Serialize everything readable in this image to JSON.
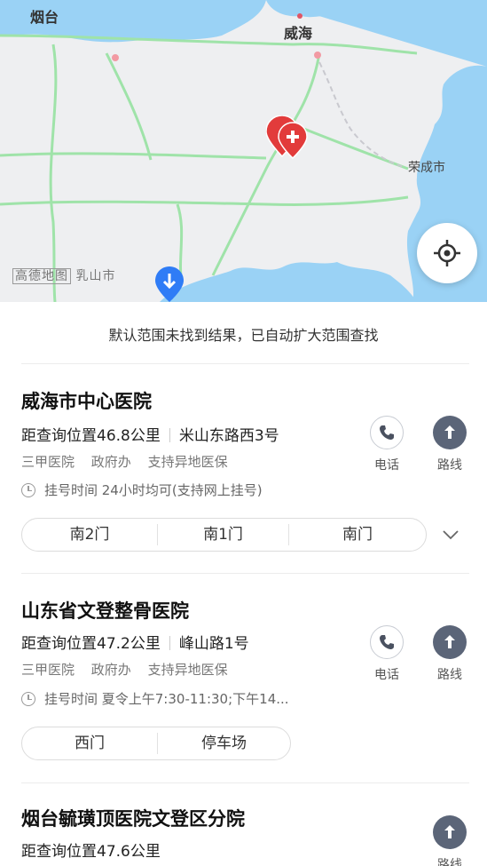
{
  "map": {
    "cities": {
      "yantai": "烟台",
      "weihai": "威海",
      "rongcheng": "荣成市",
      "rushan": "乳山市"
    },
    "watermark_brand": "高德地图",
    "colors": {
      "land": "#eeeff1",
      "sea": "#9ad2f5",
      "road": "#9fe3a9",
      "pin": "#e23b3b",
      "blue_pin": "#2f7cf6"
    }
  },
  "notice": "默认范围未找到结果，已自动扩大范围查找",
  "hospitals": [
    {
      "name": "威海市中心医院",
      "distance": "距查询位置46.8公里",
      "address": "米山东路西3号",
      "tags": [
        "三甲医院",
        "政府办",
        "支持异地医保"
      ],
      "hours": "挂号时间 24小时均可(支持网上挂号)",
      "gates": [
        "南2门",
        "南1门",
        "南门"
      ],
      "phone_label": "电话",
      "route_label": "路线"
    },
    {
      "name": "山东省文登整骨医院",
      "distance": "距查询位置47.2公里",
      "address": "峰山路1号",
      "tags": [
        "三甲医院",
        "政府办",
        "支持异地医保"
      ],
      "hours": "挂号时间 夏令上午7:30-11:30;下午14...",
      "gates": [
        "西门",
        "停车场"
      ],
      "phone_label": "电话",
      "route_label": "路线"
    },
    {
      "name": "烟台毓璜顶医院文登区分院",
      "distance": "距查询位置47.6公里",
      "route_label": "路线"
    }
  ]
}
